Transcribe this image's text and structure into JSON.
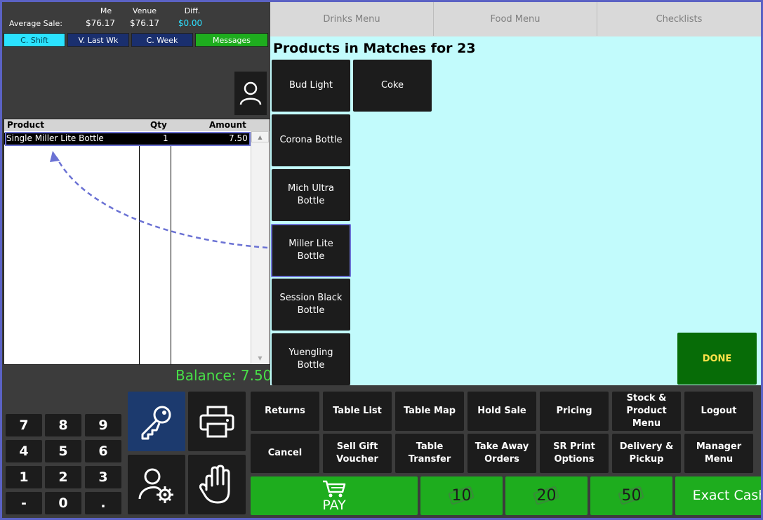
{
  "stats": {
    "label": "Average Sale:",
    "headers": [
      "Me",
      "Venue",
      "Diff."
    ],
    "values": [
      "$76.17",
      "$76.17",
      "$0.00"
    ]
  },
  "tabs": [
    "C. Shift",
    "V. Last Wk",
    "C. Week",
    "Messages"
  ],
  "order_table": {
    "columns": [
      "Product",
      "Qty",
      "Amount"
    ],
    "rows": [
      {
        "product": "Single Miller Lite Bottle",
        "qty": "1",
        "amount": "7.50"
      }
    ]
  },
  "balance": "Balance: 7.50",
  "menu_tabs": [
    "Drinks Menu",
    "Food Menu",
    "Checklists"
  ],
  "products_title": "Products in Matches for 23",
  "products": [
    "Bud Light",
    "Coke",
    "Corona Bottle",
    "Mich Ultra Bottle",
    "Miller Lite Bottle",
    "Session Black Bottle",
    "Yuengling Bottle"
  ],
  "done_label": "DONE",
  "keypad": [
    "7",
    "8",
    "9",
    "4",
    "5",
    "6",
    "1",
    "2",
    "3",
    "-",
    "0",
    "."
  ],
  "functions_row1": [
    "Returns",
    "Table List",
    "Table Map",
    "Hold Sale",
    "Pricing",
    "Stock & Product Menu",
    "Logout"
  ],
  "functions_row2": [
    "Cancel",
    "Sell Gift Voucher",
    "Table Transfer",
    "Take Away Orders",
    "SR Print Options",
    "Delivery & Pickup",
    "Manager Menu"
  ],
  "pay_label": "PAY",
  "cash_buttons": [
    "10",
    "20",
    "50"
  ],
  "exact_cash_label": "Exact Cash",
  "colors": {
    "accent": "#1ead1e",
    "products_bg": "#c2fbfc",
    "highlight": "#6b72d4",
    "balance": "#48e048"
  }
}
